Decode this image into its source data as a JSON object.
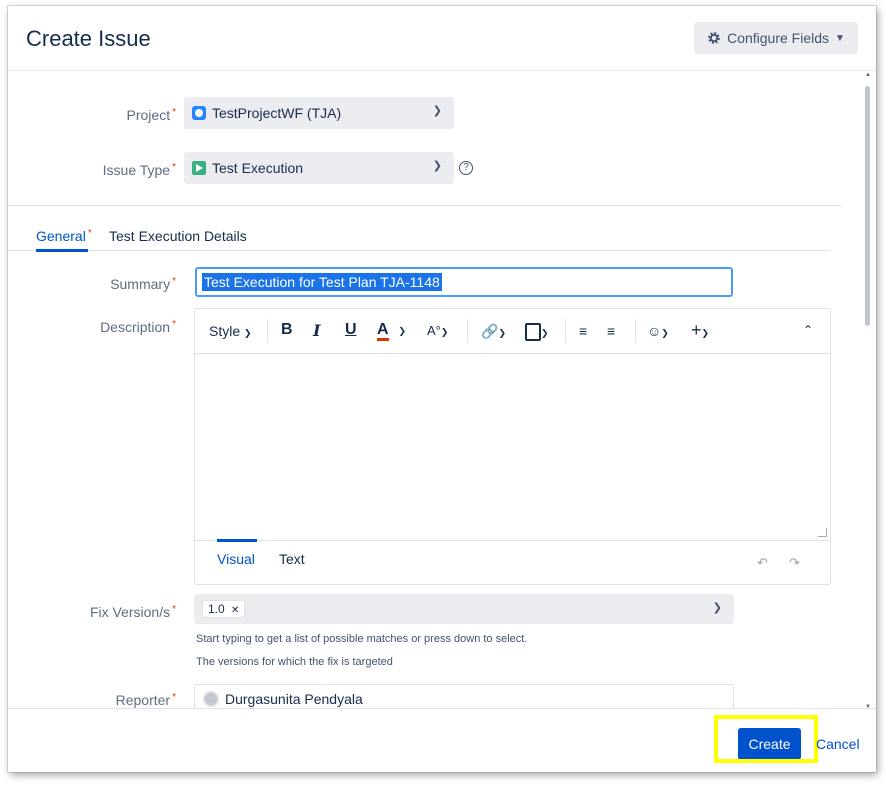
{
  "dialog": {
    "title": "Create Issue",
    "configure_fields": "Configure Fields",
    "configure_icon": "gear-icon"
  },
  "form": {
    "project": {
      "label": "Project",
      "value": "TestProjectWF (TJA)",
      "icon": "project-avatar-icon"
    },
    "issue_type": {
      "label": "Issue Type",
      "value": "Test Execution",
      "icon": "test-execution-icon",
      "help_icon": "help-icon"
    },
    "tabs": [
      {
        "label": "General",
        "active": true,
        "required": true
      },
      {
        "label": "Test Execution Details",
        "active": false
      }
    ],
    "summary": {
      "label": "Summary",
      "value": "Test Execution for Test Plan TJA-1148"
    },
    "description": {
      "label": "Description",
      "toolbar": {
        "style": "Style",
        "bold": "B",
        "italic": "I",
        "underline": "U",
        "text_color": "A"
      },
      "modes": [
        "Visual",
        "Text"
      ]
    },
    "fix_version": {
      "label": "Fix Version/s",
      "value": "1.0",
      "help1": "Start typing to get a list of possible matches or press down to select.",
      "help2": "The versions for which the fix is targeted"
    },
    "reporter": {
      "label": "Reporter",
      "value": "Durgasunita Pendyala"
    }
  },
  "footer": {
    "create": "Create",
    "cancel": "Cancel"
  },
  "colors": {
    "accent": "#0052cc",
    "required": "#de350b",
    "highlight": "#ffff00"
  }
}
